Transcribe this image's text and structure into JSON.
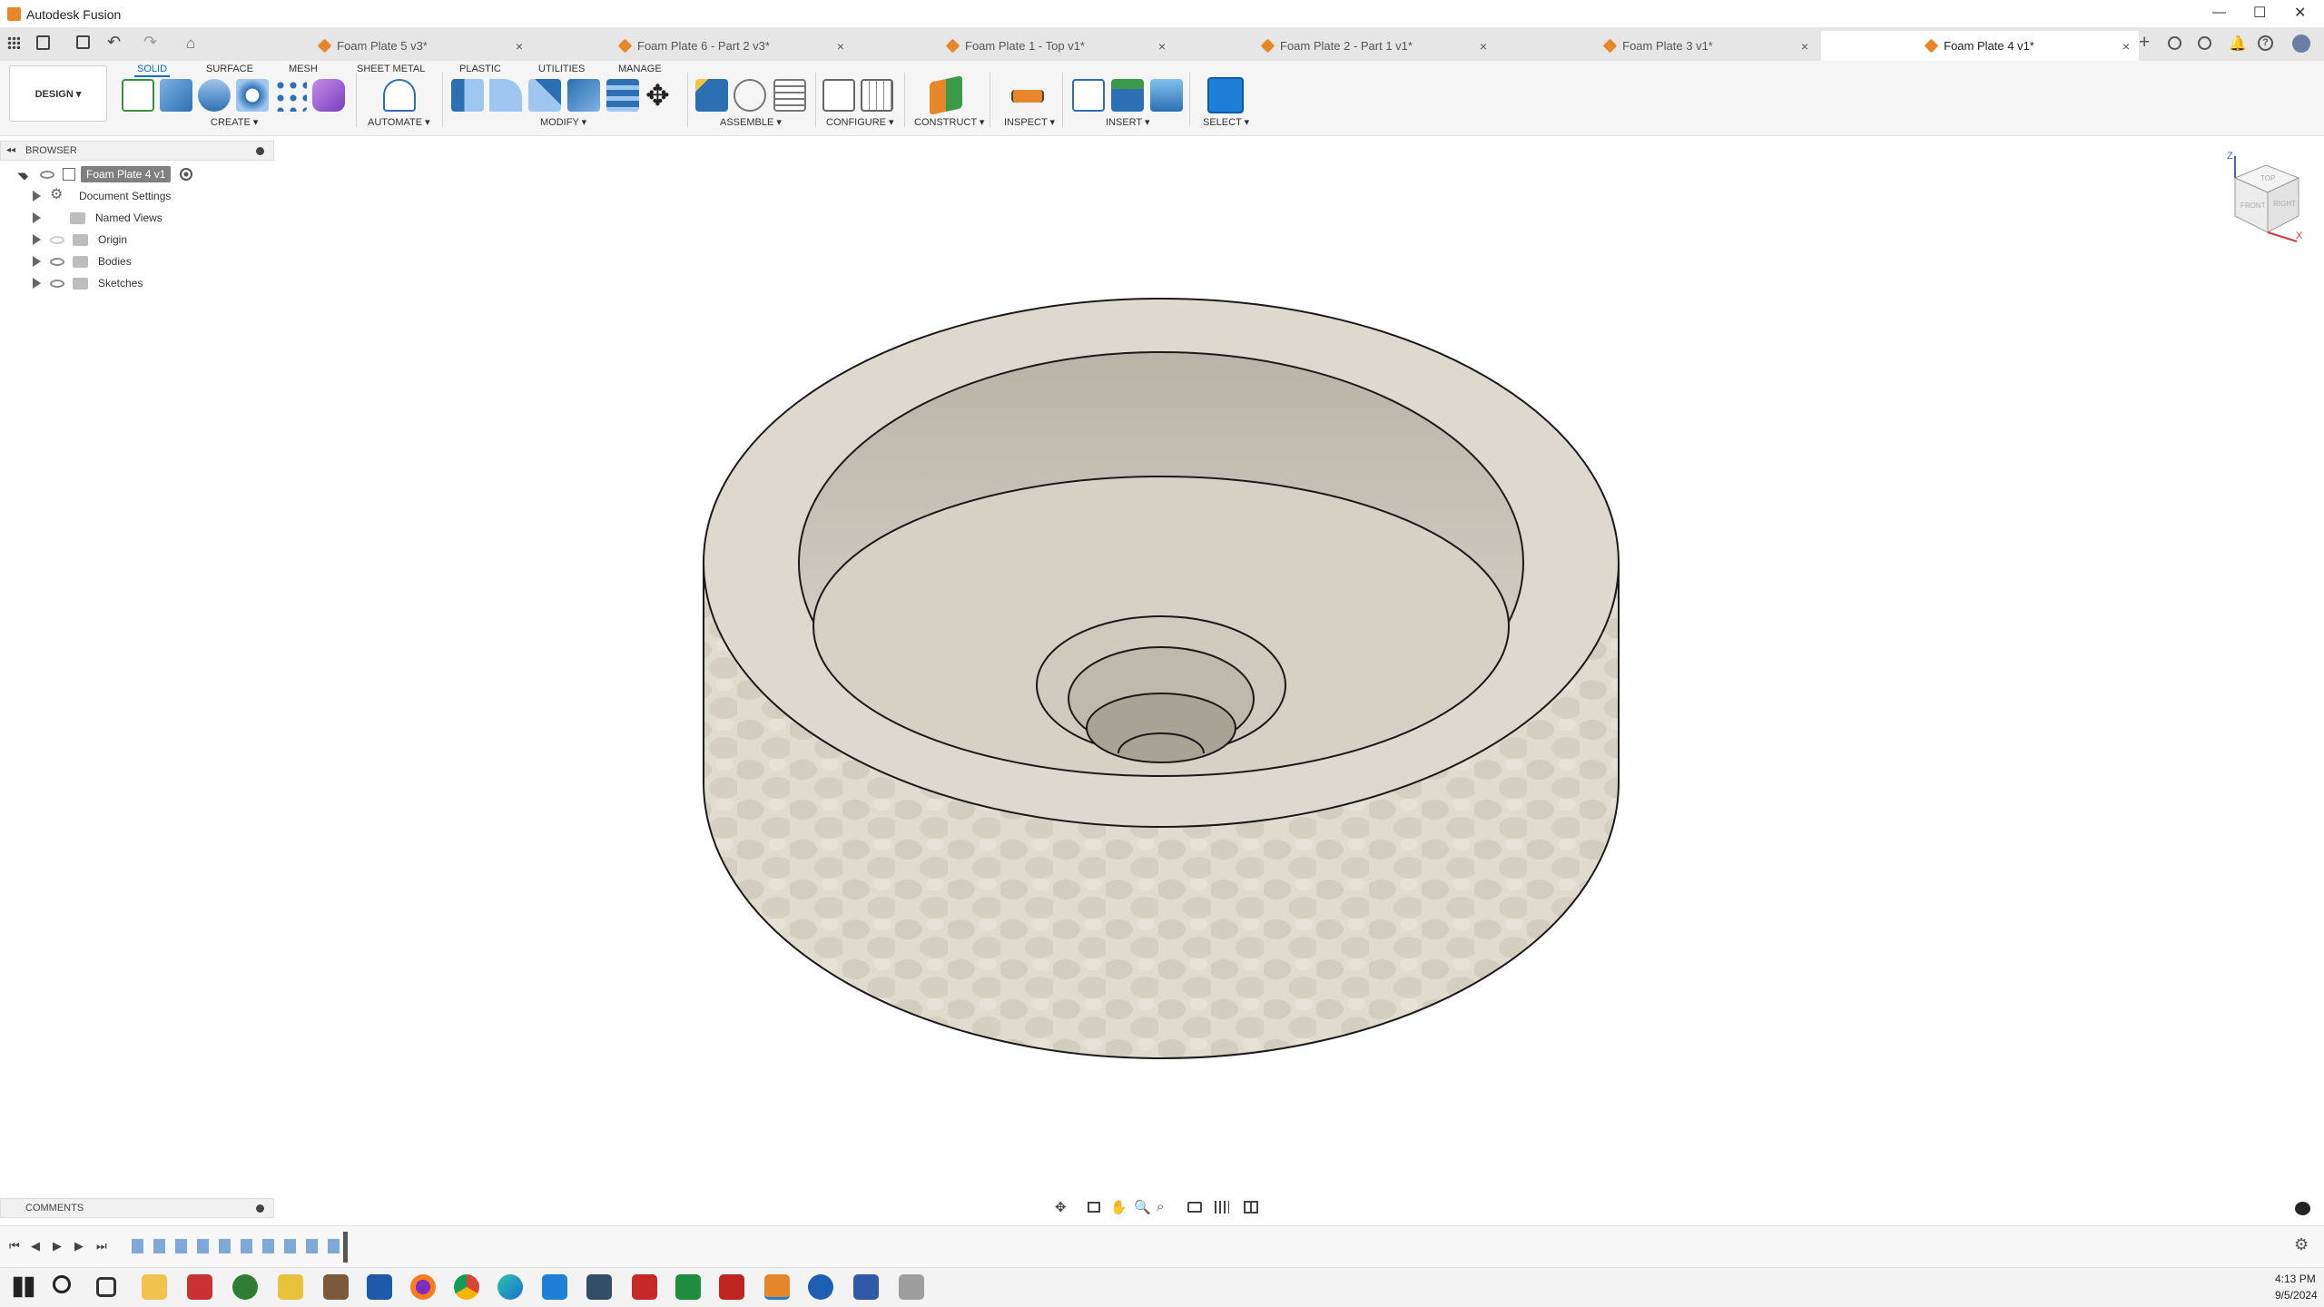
{
  "app": {
    "title": "Autodesk Fusion",
    "colors": {
      "brand": "#e8862a",
      "accent": "#0a6fc2"
    }
  },
  "document_tabs": [
    {
      "label": "Foam Plate 5 v3*",
      "close": "×"
    },
    {
      "label": "Foam Plate 6 - Part 2 v3*",
      "close": "×"
    },
    {
      "label": "Foam Plate 1 - Top v1*",
      "close": "×"
    },
    {
      "label": "Foam Plate 2 - Part 1 v1*",
      "close": "×"
    },
    {
      "label": "Foam Plate 3 v1*",
      "close": "×"
    },
    {
      "label": "Foam Plate 4 v1*",
      "close": "×",
      "active": true
    }
  ],
  "toolbar": {
    "workspace_label": "DESIGN ▾",
    "ribbon_tabs": [
      "SOLID",
      "SURFACE",
      "MESH",
      "SHEET METAL",
      "PLASTIC",
      "UTILITIES",
      "MANAGE"
    ],
    "active_tab": "SOLID",
    "groups": [
      "CREATE ▾",
      "AUTOMATE ▾",
      "MODIFY ▾",
      "ASSEMBLE ▾",
      "CONFIGURE ▾",
      "CONSTRUCT ▾",
      "INSPECT ▾",
      "INSERT ▾",
      "SELECT ▾"
    ]
  },
  "browser": {
    "header": "BROWSER",
    "collapse_glyph": "◂◂",
    "root": "Foam Plate 4 v1",
    "items": [
      "Document Settings",
      "Named Views",
      "Origin",
      "Bodies",
      "Sketches"
    ]
  },
  "comments": {
    "header": "COMMENTS"
  },
  "viewcube": {
    "faces": [
      "TOP",
      "FRONT",
      "RIGHT"
    ],
    "axes": [
      "Z",
      "X"
    ]
  },
  "taskbar": {
    "time": "4:13 PM",
    "date": "9/5/2024"
  },
  "window_controls": {
    "min": "—",
    "max": "☐",
    "close": "✕"
  }
}
